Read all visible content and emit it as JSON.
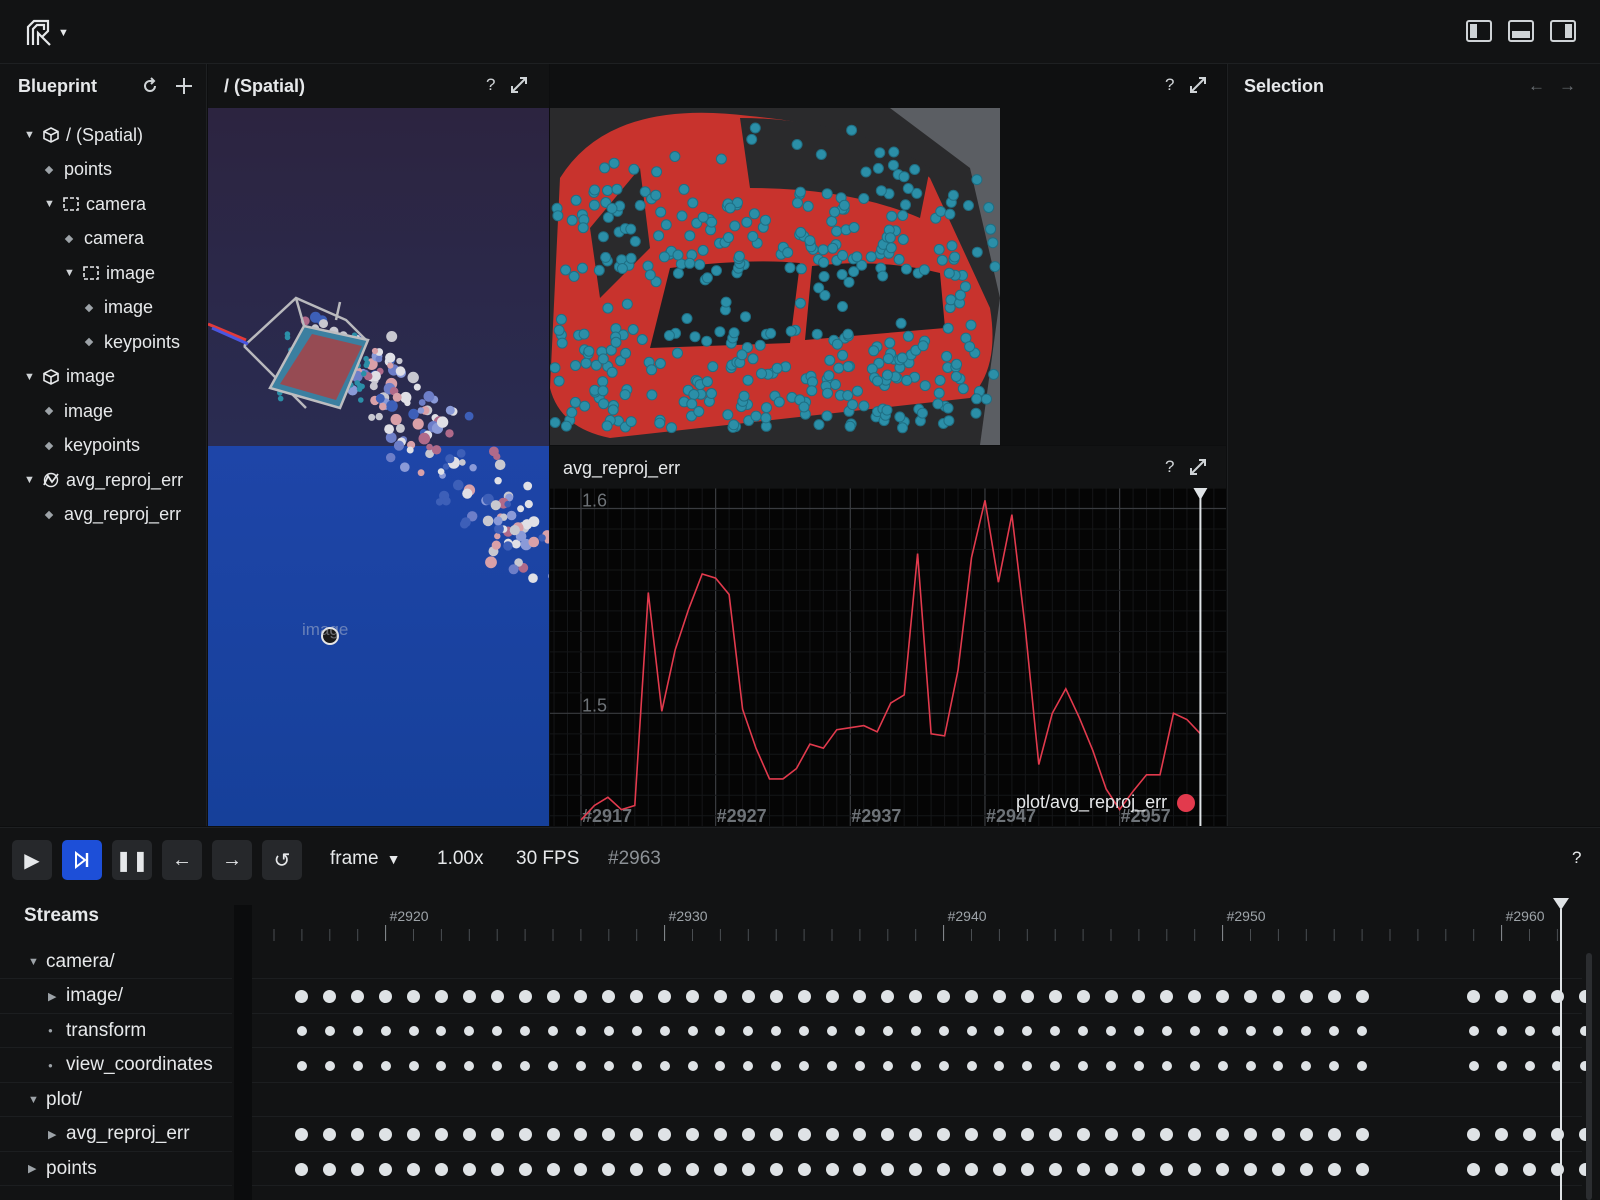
{
  "blueprint": {
    "title": "Blueprint",
    "tree": [
      {
        "label": "/ (Spatial)",
        "level": 0,
        "kind": "space3d",
        "expanded": true
      },
      {
        "label": "points",
        "level": 1,
        "kind": "entity"
      },
      {
        "label": "camera",
        "level": 1,
        "kind": "space2d",
        "expanded": true
      },
      {
        "label": "camera",
        "level": 2,
        "kind": "entity"
      },
      {
        "label": "image",
        "level": 2,
        "kind": "space2d",
        "expanded": true
      },
      {
        "label": "image",
        "level": 3,
        "kind": "entity"
      },
      {
        "label": "keypoints",
        "level": 3,
        "kind": "entity"
      },
      {
        "label": "image",
        "level": 0,
        "kind": "space3d",
        "expanded": true
      },
      {
        "label": "image",
        "level": 1,
        "kind": "entity"
      },
      {
        "label": "keypoints",
        "level": 1,
        "kind": "entity"
      },
      {
        "label": "avg_reproj_err",
        "level": 0,
        "kind": "timeseries",
        "expanded": true
      },
      {
        "label": "avg_reproj_err",
        "level": 1,
        "kind": "entity"
      }
    ]
  },
  "spatial": {
    "title": "/ (Spatial)",
    "help": "?",
    "overlay_label": "image"
  },
  "image_view": {
    "help": "?"
  },
  "plot": {
    "title": "avg_reproj_err",
    "help": "?",
    "legend": "plot/avg_reproj_err",
    "series_color": "#e23a4d"
  },
  "chart_data": {
    "type": "line",
    "title": "avg_reproj_err",
    "xlabel": "",
    "ylabel": "",
    "x_tick_labels": [
      "#2917",
      "#2927",
      "#2937",
      "#2947",
      "#2957"
    ],
    "y_tick_labels": [
      "1.5",
      "1.6"
    ],
    "ylim": [
      1.445,
      1.61
    ],
    "xlim": [
      2914.7,
      2964.9
    ],
    "series": [
      {
        "name": "plot/avg_reproj_err",
        "x": [
          2917,
          2918,
          2919,
          2920,
          2921,
          2922,
          2923,
          2924,
          2925,
          2926,
          2927,
          2928,
          2929,
          2930,
          2931,
          2932,
          2933,
          2934,
          2935,
          2936,
          2937,
          2938,
          2939,
          2940,
          2941,
          2942,
          2943,
          2944,
          2945,
          2946,
          2947,
          2948,
          2949,
          2950,
          2951,
          2952,
          2953,
          2954,
          2955,
          2956,
          2957,
          2958,
          2959,
          2960,
          2961,
          2962,
          2963
        ],
        "y": [
          1.448,
          1.455,
          1.459,
          1.453,
          1.455,
          1.559,
          1.501,
          1.531,
          1.551,
          1.568,
          1.566,
          1.558,
          1.502,
          1.483,
          1.468,
          1.468,
          1.473,
          1.485,
          1.483,
          1.492,
          1.493,
          1.494,
          1.491,
          1.505,
          1.509,
          1.578,
          1.49,
          1.489,
          1.521,
          1.576,
          1.604,
          1.564,
          1.597,
          1.541,
          1.475,
          1.5,
          1.512,
          1.498,
          1.482,
          1.463,
          1.453,
          1.462,
          1.47,
          1.47,
          1.5,
          1.497,
          1.49
        ]
      }
    ],
    "current_frame": 2963
  },
  "selection": {
    "title": "Selection"
  },
  "timebar": {
    "timeline": "frame",
    "speed": "1.00x",
    "fps": "30 FPS",
    "frame": "#2963",
    "help": "?"
  },
  "streams": {
    "title": "Streams",
    "ticks": [
      "#2920",
      "#2930",
      "#2940",
      "#2950",
      "#2960"
    ],
    "rows": [
      {
        "label": "camera/",
        "level": 0,
        "toggle": "open",
        "dots": false
      },
      {
        "label": "image/",
        "level": 1,
        "toggle": "closed",
        "dots": true
      },
      {
        "label": "transform",
        "level": 1,
        "toggle": "leaf",
        "dots": true
      },
      {
        "label": "view_coordinates",
        "level": 1,
        "toggle": "leaf",
        "dots": true
      },
      {
        "label": "plot/",
        "level": 0,
        "toggle": "open",
        "dots": false
      },
      {
        "label": "avg_reproj_err",
        "level": 1,
        "toggle": "closed",
        "dots": true
      },
      {
        "label": "points",
        "level": 0,
        "toggle": "closed",
        "dots": true
      }
    ]
  },
  "colors": {
    "accent": "#1d4fd8",
    "series": "#e23a4d",
    "point": "#2b8fa8"
  }
}
